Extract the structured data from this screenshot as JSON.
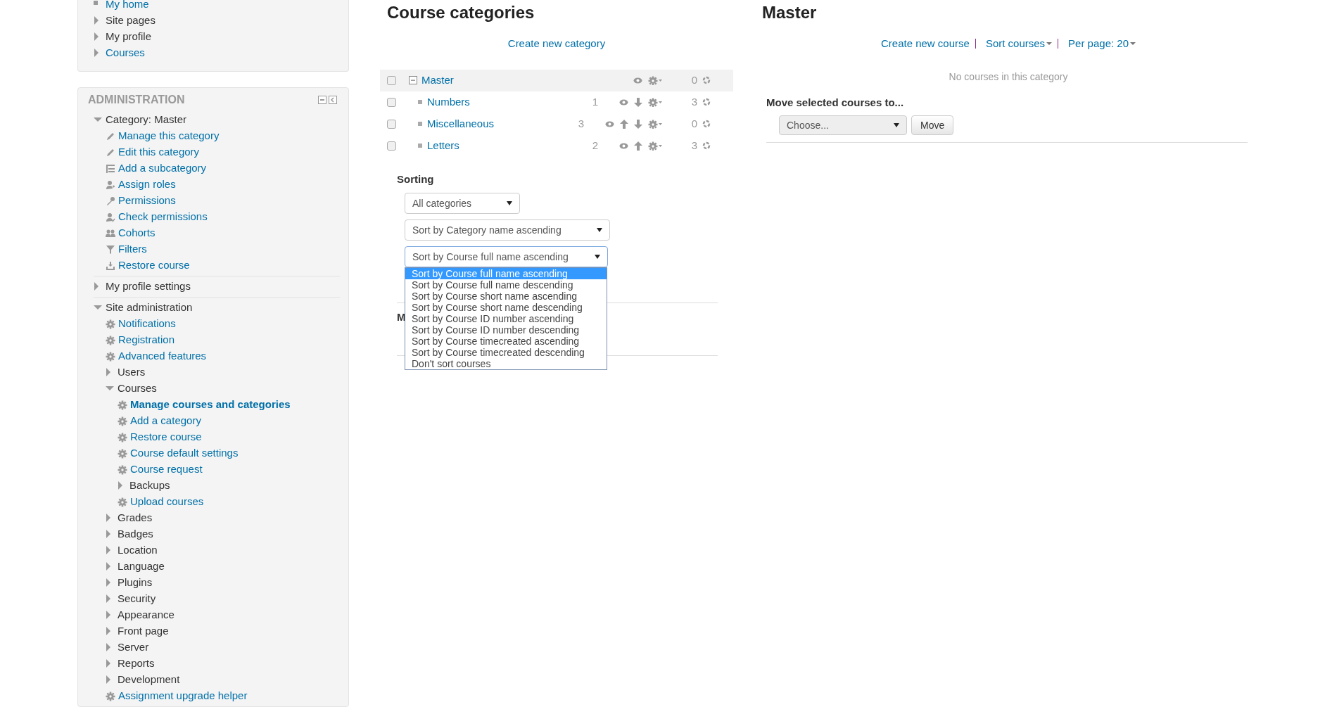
{
  "navigation": {
    "items": [
      {
        "label": "My home",
        "kind": "bullet",
        "link": true
      },
      {
        "label": "Site pages",
        "kind": "branch",
        "link": false,
        "expanded": false
      },
      {
        "label": "My profile",
        "kind": "branch",
        "link": false,
        "expanded": false
      },
      {
        "label": "Courses",
        "kind": "branch",
        "link": true,
        "expanded": false
      }
    ]
  },
  "administration": {
    "title": "ADMINISTRATION",
    "items": [
      {
        "label": "Category: Master",
        "kind": "branch",
        "link": false,
        "expanded": true,
        "children": [
          {
            "label": "Manage this category",
            "kind": "edit",
            "link": true
          },
          {
            "label": "Edit this category",
            "kind": "edit",
            "link": true
          },
          {
            "label": "Add a subcategory",
            "kind": "add-subcategory",
            "link": true
          },
          {
            "label": "Assign roles",
            "kind": "roles",
            "link": true
          },
          {
            "label": "Permissions",
            "kind": "permissions",
            "link": true
          },
          {
            "label": "Check permissions",
            "kind": "check-permissions",
            "link": true
          },
          {
            "label": "Cohorts",
            "kind": "cohorts",
            "link": true
          },
          {
            "label": "Filters",
            "kind": "filters",
            "link": true
          },
          {
            "label": "Restore course",
            "kind": "restore",
            "link": true
          }
        ]
      },
      {
        "label": "My profile settings",
        "kind": "branch",
        "link": false,
        "expanded": false
      },
      {
        "label": "Site administration",
        "kind": "branch",
        "link": false,
        "expanded": true,
        "children": [
          {
            "label": "Notifications",
            "kind": "setting",
            "link": true
          },
          {
            "label": "Registration",
            "kind": "setting",
            "link": true
          },
          {
            "label": "Advanced features",
            "kind": "setting",
            "link": true
          },
          {
            "label": "Users",
            "kind": "branch",
            "link": false,
            "expanded": false
          },
          {
            "label": "Courses",
            "kind": "branch",
            "link": false,
            "expanded": true,
            "children": [
              {
                "label": "Manage courses and categories",
                "kind": "setting",
                "link": true,
                "selected": true
              },
              {
                "label": "Add a category",
                "kind": "setting",
                "link": true,
                "selected": false
              },
              {
                "label": "Restore course",
                "kind": "setting",
                "link": true,
                "selected": false
              },
              {
                "label": "Course default settings",
                "kind": "setting",
                "link": true,
                "selected": false
              },
              {
                "label": "Course request",
                "kind": "setting",
                "link": true,
                "selected": false
              },
              {
                "label": "Backups",
                "kind": "branch",
                "link": false,
                "expanded": false,
                "selected": false
              },
              {
                "label": "Upload courses",
                "kind": "setting",
                "link": true,
                "selected": false
              }
            ]
          },
          {
            "label": "Grades",
            "kind": "branch",
            "link": false,
            "expanded": false
          },
          {
            "label": "Badges",
            "kind": "branch",
            "link": false,
            "expanded": false
          },
          {
            "label": "Location",
            "kind": "branch",
            "link": false,
            "expanded": false
          },
          {
            "label": "Language",
            "kind": "branch",
            "link": false,
            "expanded": false
          },
          {
            "label": "Plugins",
            "kind": "branch",
            "link": false,
            "expanded": false
          },
          {
            "label": "Security",
            "kind": "branch",
            "link": false,
            "expanded": false
          },
          {
            "label": "Appearance",
            "kind": "branch",
            "link": false,
            "expanded": false
          },
          {
            "label": "Front page",
            "kind": "branch",
            "link": false,
            "expanded": false
          },
          {
            "label": "Server",
            "kind": "branch",
            "link": false,
            "expanded": false
          },
          {
            "label": "Reports",
            "kind": "branch",
            "link": false,
            "expanded": false
          },
          {
            "label": "Development",
            "kind": "branch",
            "link": false,
            "expanded": false
          },
          {
            "label": "Assignment upgrade helper",
            "kind": "setting",
            "link": true
          }
        ]
      }
    ]
  },
  "categories_panel": {
    "title": "Course categories",
    "create_link": "Create new category",
    "categories": [
      {
        "name": "Master",
        "checked": false,
        "selected": true,
        "expanded": true,
        "move_up": false,
        "move_down": false,
        "courses": "0",
        "children": [
          {
            "name": "Numbers",
            "checked": false,
            "selected": false,
            "subcategories": "1",
            "move_up": false,
            "move_down": true,
            "courses": "3"
          },
          {
            "name": "Miscellaneous",
            "checked": false,
            "selected": false,
            "subcategories": "3",
            "move_up": true,
            "move_down": true,
            "courses": "0"
          },
          {
            "name": "Letters",
            "checked": false,
            "selected": false,
            "subcategories": "2",
            "move_up": true,
            "move_down": false,
            "courses": "3"
          }
        ]
      }
    ],
    "sorting": {
      "label": "Sorting",
      "selects": [
        {
          "value": "All categories",
          "open": false
        },
        {
          "value": "Sort by Category name ascending",
          "open": false
        },
        {
          "value": "Sort by Course full name ascending",
          "open": true,
          "options": [
            {
              "label": "Sort by Course full name ascending",
              "selected": true
            },
            {
              "label": "Sort by Course full name descending",
              "selected": false
            },
            {
              "label": "Sort by Course short name ascending",
              "selected": false
            },
            {
              "label": "Sort by Course short name descending",
              "selected": false
            },
            {
              "label": "Sort by Course ID number ascending",
              "selected": false
            },
            {
              "label": "Sort by Course ID number descending",
              "selected": false
            },
            {
              "label": "Sort by Course timecreated ascending",
              "selected": false
            },
            {
              "label": "Sort by Course timecreated descending",
              "selected": false
            },
            {
              "label": "Don't sort courses",
              "selected": false
            }
          ]
        }
      ]
    },
    "hidden_section_label": "M"
  },
  "courses_panel": {
    "title": "Master",
    "links": [
      {
        "label": "Create new course",
        "dropdown": false
      },
      {
        "label": "Sort courses",
        "dropdown": true
      },
      {
        "label": "Per page: 20",
        "dropdown": true
      }
    ],
    "empty_message": "No courses in this category",
    "move_label": "Move selected courses to...",
    "move_select": "Choose...",
    "move_button": "Move"
  }
}
